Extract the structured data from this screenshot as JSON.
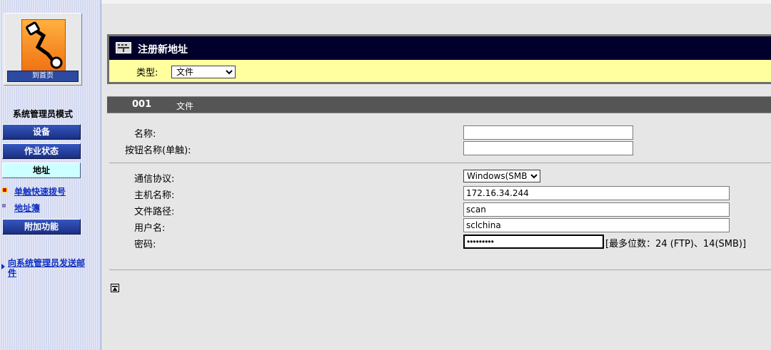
{
  "sidebar": {
    "home_label": "到首页",
    "mode_title": "系统管理员模式",
    "nav": {
      "device": "设备",
      "job_status": "作业状态",
      "address": "地址",
      "extra": "附加功能"
    },
    "sub_links": {
      "speed_dial": "单触快速拨号",
      "address_book": "地址簿"
    },
    "mail_link": "向系统管理员发送邮件"
  },
  "header": {
    "title": "注册新地址",
    "type_label": "类型:",
    "type_value": "文件"
  },
  "section": {
    "number": "001",
    "type": "文件"
  },
  "form": {
    "name_label": "名称:",
    "name_value": "",
    "button_name_label": "按钮名称(单触):",
    "button_name_value": "",
    "protocol_label": "通信协议:",
    "protocol_value": "Windows(SMB)",
    "host_label": "主机名称:",
    "host_value": "172.16.34.244",
    "path_label": "文件路径:",
    "path_value": "scan",
    "user_label": "用户名:",
    "user_value": "sclchina",
    "password_label": "密码:",
    "password_value": "•••••••••",
    "password_hint": "[最多位数：24 (FTP)、14(SMB)]"
  },
  "colors": {
    "header_bg": "#ffffa0",
    "title_bar": "#00002a",
    "section_bar": "#555555",
    "nav_button": "#1a2f82",
    "nav_active": "#ccffff",
    "link": "#1030c0"
  },
  "icons": {
    "logo": "network-logo-icon",
    "header": "keypad-icon",
    "top": "page-top-icon"
  }
}
